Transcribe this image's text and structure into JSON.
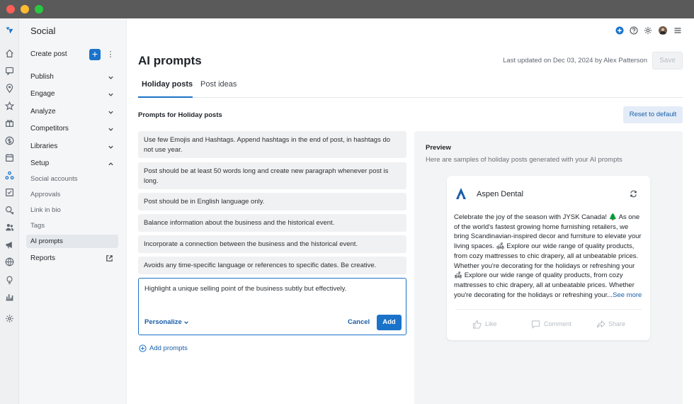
{
  "sidebar": {
    "title": "Social",
    "create_post": "Create post",
    "items": [
      {
        "label": "Publish"
      },
      {
        "label": "Engage"
      },
      {
        "label": "Analyze"
      },
      {
        "label": "Competitors"
      },
      {
        "label": "Libraries"
      },
      {
        "label": "Setup"
      }
    ],
    "setup_subitems": [
      {
        "label": "Social accounts"
      },
      {
        "label": "Approvals"
      },
      {
        "label": "Link in bio"
      },
      {
        "label": "Tags"
      },
      {
        "label": "AI prompts"
      }
    ],
    "reports": "Reports"
  },
  "header": {
    "title": "AI prompts",
    "last_updated": "Last updated on Dec 03, 2024 by Alex Patterson",
    "save_label": "Save"
  },
  "tabs": [
    {
      "label": "Holiday posts"
    },
    {
      "label": "Post ideas"
    }
  ],
  "prompts_section": {
    "label": "Prompts for Holiday posts",
    "reset_label": "Reset to default",
    "prompts": [
      "Use few Emojis and Hashtags. Append hashtags in the end of post, in hashtags do not use year.",
      "Post should be at least 50 words long and create new paragraph whenever post is long.",
      "Post should be in English language only.",
      "Balance information about the business and the historical event.",
      "Incorporate a connection between the business and the historical event.",
      "Avoids any time-specific language or references to specific dates. Be creative."
    ],
    "editor_value": "Highlight a unique selling point of the business subtly but effectively.",
    "personalize_label": "Personalize",
    "cancel_label": "Cancel",
    "add_label": "Add",
    "add_prompts_label": "Add prompts"
  },
  "preview": {
    "title": "Preview",
    "subtitle": "Here are samples of holiday posts generated with your AI prompts",
    "card": {
      "business_name": "Aspen Dental",
      "body": "Celebrate the joy of the season with JYSK Canada! 🌲 As one of the world's fastest growing home furnishing retailers, we bring Scandinavian-inspired decor and furniture to elevate your living spaces. 🛋 Explore our wide range of quality products, from cozy mattresses to chic drapery, all at unbeatable prices. Whether you're decorating for the holidays or refreshing your 🛋 Explore our wide range of quality products, from cozy mattresses to chic drapery, all at unbeatable prices. Whether you're decorating for the holidays or refreshing your...",
      "see_more": "See more",
      "actions": {
        "like": "Like",
        "comment": "Comment",
        "share": "Share"
      }
    }
  },
  "icons": {
    "rail": [
      "logo-icon",
      "home-icon",
      "inbox-icon",
      "location-icon",
      "star-icon",
      "gift-icon",
      "dollar-icon",
      "calendar-icon",
      "social-icon",
      "checklist-icon",
      "chat-icon",
      "people-icon",
      "megaphone-icon",
      "globe-icon",
      "bulb-icon",
      "chart-icon",
      "settings-icon"
    ],
    "top": [
      "add-circle-icon",
      "help-icon",
      "gear-icon",
      "avatar",
      "menu-icon"
    ]
  },
  "colors": {
    "accent": "#1a73c9",
    "link": "#1a5fa8"
  }
}
